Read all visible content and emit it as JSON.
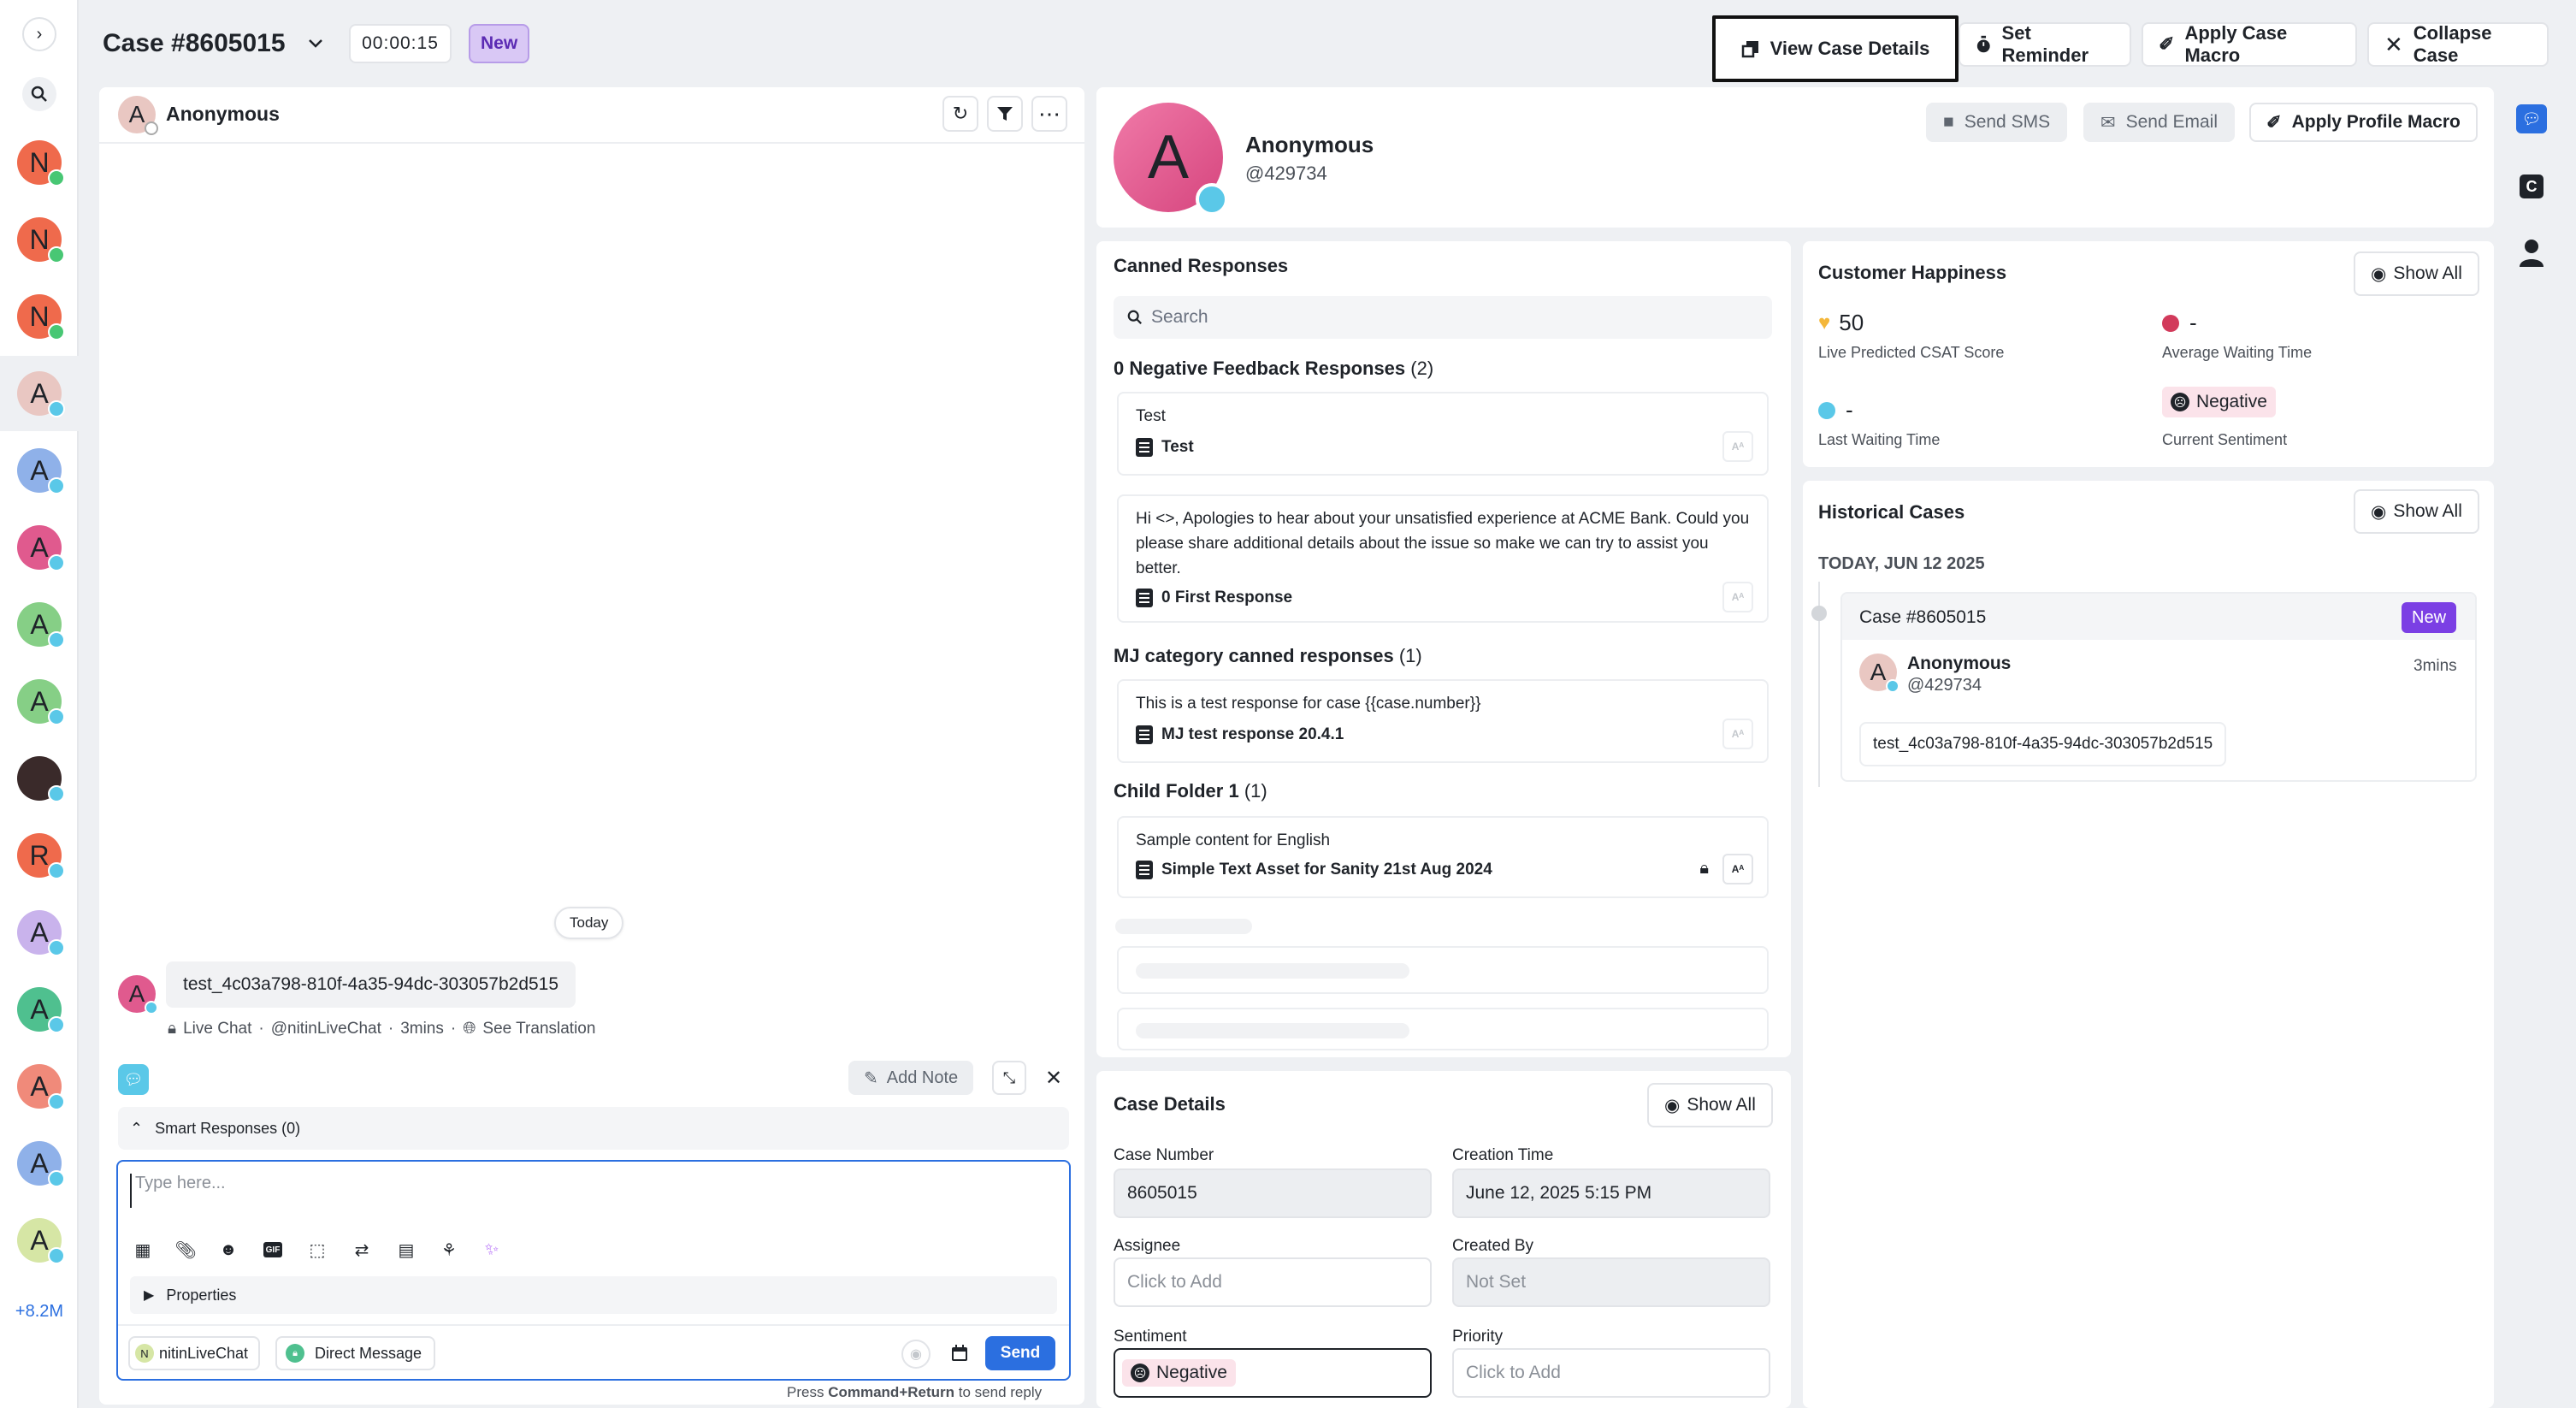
{
  "header": {
    "case_title": "Case #8605015",
    "timer": "00:00:15",
    "status_badge": "New",
    "view_case_details": "View Case Details",
    "set_reminder": "Set Reminder",
    "apply_case_macro": "Apply Case Macro",
    "collapse_case": "Collapse Case"
  },
  "rail": {
    "avatars": [
      "N",
      "N",
      "N",
      "A",
      "A",
      "A",
      "A",
      "A",
      "",
      "R",
      "A",
      "A",
      "A",
      "A",
      "A"
    ],
    "more_count": "+8.2M"
  },
  "conversation": {
    "contact_name": "Anonymous",
    "contact_initial": "A",
    "date_divider": "Today",
    "message_text": "test_4c03a798-810f-4a35-94dc-303057b2d515",
    "message_meta_channel": "Live Chat",
    "message_meta_handle": "@nitinLiveChat",
    "message_meta_time": "3mins",
    "see_translation": "See Translation",
    "add_note": "Add Note",
    "smart_responses": "Smart Responses (0)",
    "reply_placeholder": "Type here...",
    "properties": "Properties",
    "account_chip": "nitinLiveChat",
    "account_chip_initial": "N",
    "direct_message": "Direct Message",
    "send": "Send",
    "shortcut_prefix": "Press",
    "shortcut_key": "Command+Return",
    "shortcut_suffix": "to send reply"
  },
  "profile": {
    "initial": "A",
    "name": "Anonymous",
    "handle": "@429734",
    "send_sms": "Send SMS",
    "send_email": "Send Email",
    "apply_profile_macro": "Apply Profile Macro"
  },
  "canned": {
    "title": "Canned Responses",
    "search_placeholder": "Search",
    "group1_title": "0 Negative Feedback Responses",
    "group1_count": "(2)",
    "r1_body": "Test",
    "r1_title": "Test",
    "r2_body": "Hi <>, Apologies to hear about your unsatisfied experience at ACME Bank. Could you please share additional details about the issue so make we can try to assist you better.",
    "r2_title": "0 First Response",
    "group2_title": "MJ category canned responses",
    "group2_count": "(1)",
    "r3_body": "This is a test response for case {{case.number}}",
    "r3_title": "MJ test response 20.4.1",
    "group3_title": "Child Folder 1",
    "group3_count": "(1)",
    "r4_body": "Sample content for English",
    "r4_title": "Simple Text Asset for Sanity 21st Aug 2024",
    "ax_label": "Aᴬ"
  },
  "happiness": {
    "title": "Customer Happiness",
    "show_all": "Show All",
    "csat_value": "50",
    "csat_label": "Live Predicted CSAT Score",
    "avg_wait_value": "-",
    "avg_wait_label": "Average Waiting Time",
    "last_wait_value": "-",
    "last_wait_label": "Last Waiting Time",
    "sentiment_value": "Negative",
    "sentiment_label": "Current Sentiment"
  },
  "historical": {
    "title": "Historical Cases",
    "show_all": "Show All",
    "date": "TODAY, JUN 12 2025",
    "case_title": "Case #8605015",
    "case_badge": "New",
    "contact_name": "Anonymous",
    "contact_handle": "@429734",
    "time": "3mins",
    "message": "test_4c03a798-810f-4a35-94dc-303057b2d515"
  },
  "case_details": {
    "title": "Case Details",
    "show_all": "Show All",
    "case_number_label": "Case Number",
    "case_number_value": "8605015",
    "creation_time_label": "Creation Time",
    "creation_time_value": "June 12, 2025 5:15 PM",
    "assignee_label": "Assignee",
    "assignee_placeholder": "Click to Add",
    "created_by_label": "Created By",
    "created_by_value": "Not Set",
    "sentiment_label": "Sentiment",
    "sentiment_value": "Negative",
    "priority_label": "Priority",
    "priority_placeholder": "Click to Add"
  },
  "right_rail": {
    "c_label": "C"
  },
  "colors": {
    "accent": "#2b6fe0",
    "badge_new_bg": "#d9c8f5",
    "badge_new_purple": "#7b3fe4",
    "avatar_pink": "#e05a8e",
    "sentiment_bg": "#fbe3ea"
  }
}
